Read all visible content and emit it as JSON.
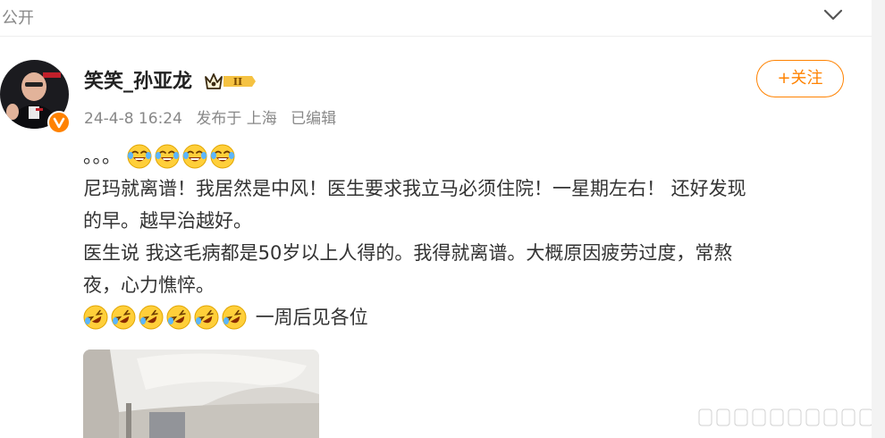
{
  "topbar": {
    "visibility_label": "公开"
  },
  "author": {
    "name": "笑笑_孙亚龙",
    "vip_level": "II"
  },
  "post_meta": {
    "date": "24-4-8 16:24",
    "source": "发布于 上海",
    "edited": "已编辑"
  },
  "follow_button": {
    "label": "+关注"
  },
  "post_body": {
    "line1_prefix": "。。。",
    "line2": "尼玛就离谱！我居然是中风！医生要求我立马必须住院！一星期左右！ 还好发现",
    "line3": "的早。越早治越好。",
    "line4": "医生说 我这毛病都是50岁以上人得的。我得就离谱。大概原因疲劳过度，常熬",
    "line5": "夜，心力憔悴。",
    "line6_suffix": "一周后见各位"
  },
  "emojis": {
    "laugh_cry_count": 4,
    "sob_laugh_count": 6,
    "laugh_cry_icon": "laugh-tears-icon",
    "sob_laugh_icon": "rolling-laugh-icon"
  },
  "colors": {
    "accent_orange": "#ff8200",
    "meta_gray": "#888888",
    "text": "#333333",
    "verified_badge": "#ff8200"
  }
}
